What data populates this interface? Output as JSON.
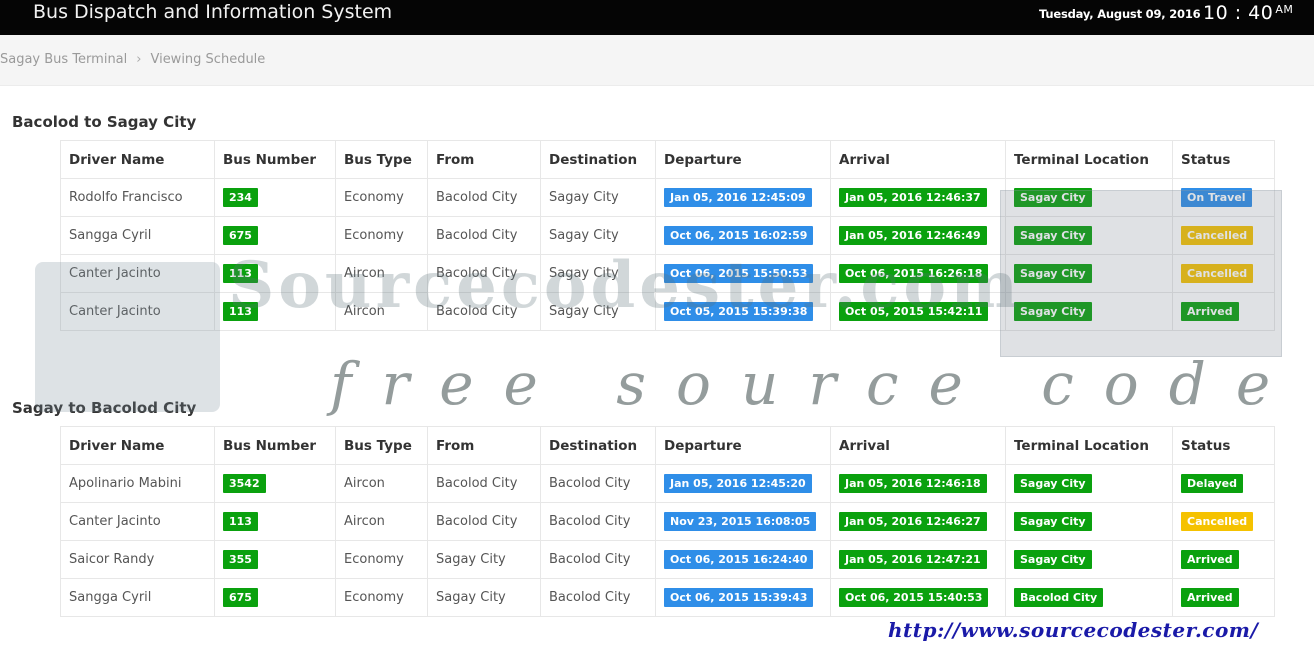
{
  "header": {
    "app_title": "Bus Dispatch and Information System",
    "date": "Tuesday, August 09, 2016",
    "time": "10 : 40",
    "ampm": "AM"
  },
  "breadcrumb": {
    "terminal": "Sagay Bus Terminal",
    "separator": "›",
    "current": "Viewing Schedule"
  },
  "columns": [
    "Driver Name",
    "Bus Number",
    "Bus Type",
    "From",
    "Destination",
    "Departure",
    "Arrival",
    "Terminal Location",
    "Status"
  ],
  "colors": {
    "green": "#0aa10e",
    "blue": "#2f8ee8",
    "yellow": "#f5c200",
    "topbar": "#050505"
  },
  "sections": [
    {
      "title": "Bacolod to Sagay City",
      "rows": [
        {
          "driver": "Rodolfo Francisco",
          "bus_number": "234",
          "bus_type": "Economy",
          "from": "Bacolod City",
          "destination": "Sagay City",
          "departure": "Jan 05, 2016 12:45:09",
          "arrival": "Jan 05, 2016 12:46:37",
          "terminal": "Sagay City",
          "status": "On Travel",
          "status_color": "blue"
        },
        {
          "driver": "Sangga Cyril",
          "bus_number": "675",
          "bus_type": "Economy",
          "from": "Bacolod City",
          "destination": "Sagay City",
          "departure": "Oct 06, 2015 16:02:59",
          "arrival": "Jan 05, 2016 12:46:49",
          "terminal": "Sagay City",
          "status": "Cancelled",
          "status_color": "yellow"
        },
        {
          "driver": "Canter Jacinto",
          "bus_number": "113",
          "bus_type": "Aircon",
          "from": "Bacolod City",
          "destination": "Sagay City",
          "departure": "Oct 06, 2015 15:50:53",
          "arrival": "Oct 06, 2015 16:26:18",
          "terminal": "Sagay City",
          "status": "Cancelled",
          "status_color": "yellow"
        },
        {
          "driver": "Canter Jacinto",
          "bus_number": "113",
          "bus_type": "Aircon",
          "from": "Bacolod City",
          "destination": "Sagay City",
          "departure": "Oct 05, 2015 15:39:38",
          "arrival": "Oct 05, 2015 15:42:11",
          "terminal": "Sagay City",
          "status": "Arrived",
          "status_color": "green"
        }
      ]
    },
    {
      "title": "Sagay to Bacolod City",
      "rows": [
        {
          "driver": "Apolinario Mabini",
          "bus_number": "3542",
          "bus_type": "Aircon",
          "from": "Bacolod City",
          "destination": "Bacolod City",
          "departure": "Jan 05, 2016 12:45:20",
          "arrival": "Jan 05, 2016 12:46:18",
          "terminal": "Sagay City",
          "status": "Delayed",
          "status_color": "green"
        },
        {
          "driver": "Canter Jacinto",
          "bus_number": "113",
          "bus_type": "Aircon",
          "from": "Bacolod City",
          "destination": "Bacolod City",
          "departure": "Nov 23, 2015 16:08:05",
          "arrival": "Jan 05, 2016 12:46:27",
          "terminal": "Sagay City",
          "status": "Cancelled",
          "status_color": "yellow"
        },
        {
          "driver": "Saicor Randy",
          "bus_number": "355",
          "bus_type": "Economy",
          "from": "Sagay City",
          "destination": "Bacolod City",
          "departure": "Oct 06, 2015 16:24:40",
          "arrival": "Jan 05, 2016 12:47:21",
          "terminal": "Sagay City",
          "status": "Arrived",
          "status_color": "green"
        },
        {
          "driver": "Sangga Cyril",
          "bus_number": "675",
          "bus_type": "Economy",
          "from": "Sagay City",
          "destination": "Bacolod City",
          "departure": "Oct 06, 2015 15:39:43",
          "arrival": "Oct 06, 2015 15:40:53",
          "terminal": "Bacolod City",
          "status": "Arrived",
          "status_color": "green"
        }
      ]
    }
  ],
  "watermark": {
    "logo_text": "Sourcecodester.com",
    "tagline": "free source code",
    "url": "http://www.sourcecodester.com/"
  }
}
